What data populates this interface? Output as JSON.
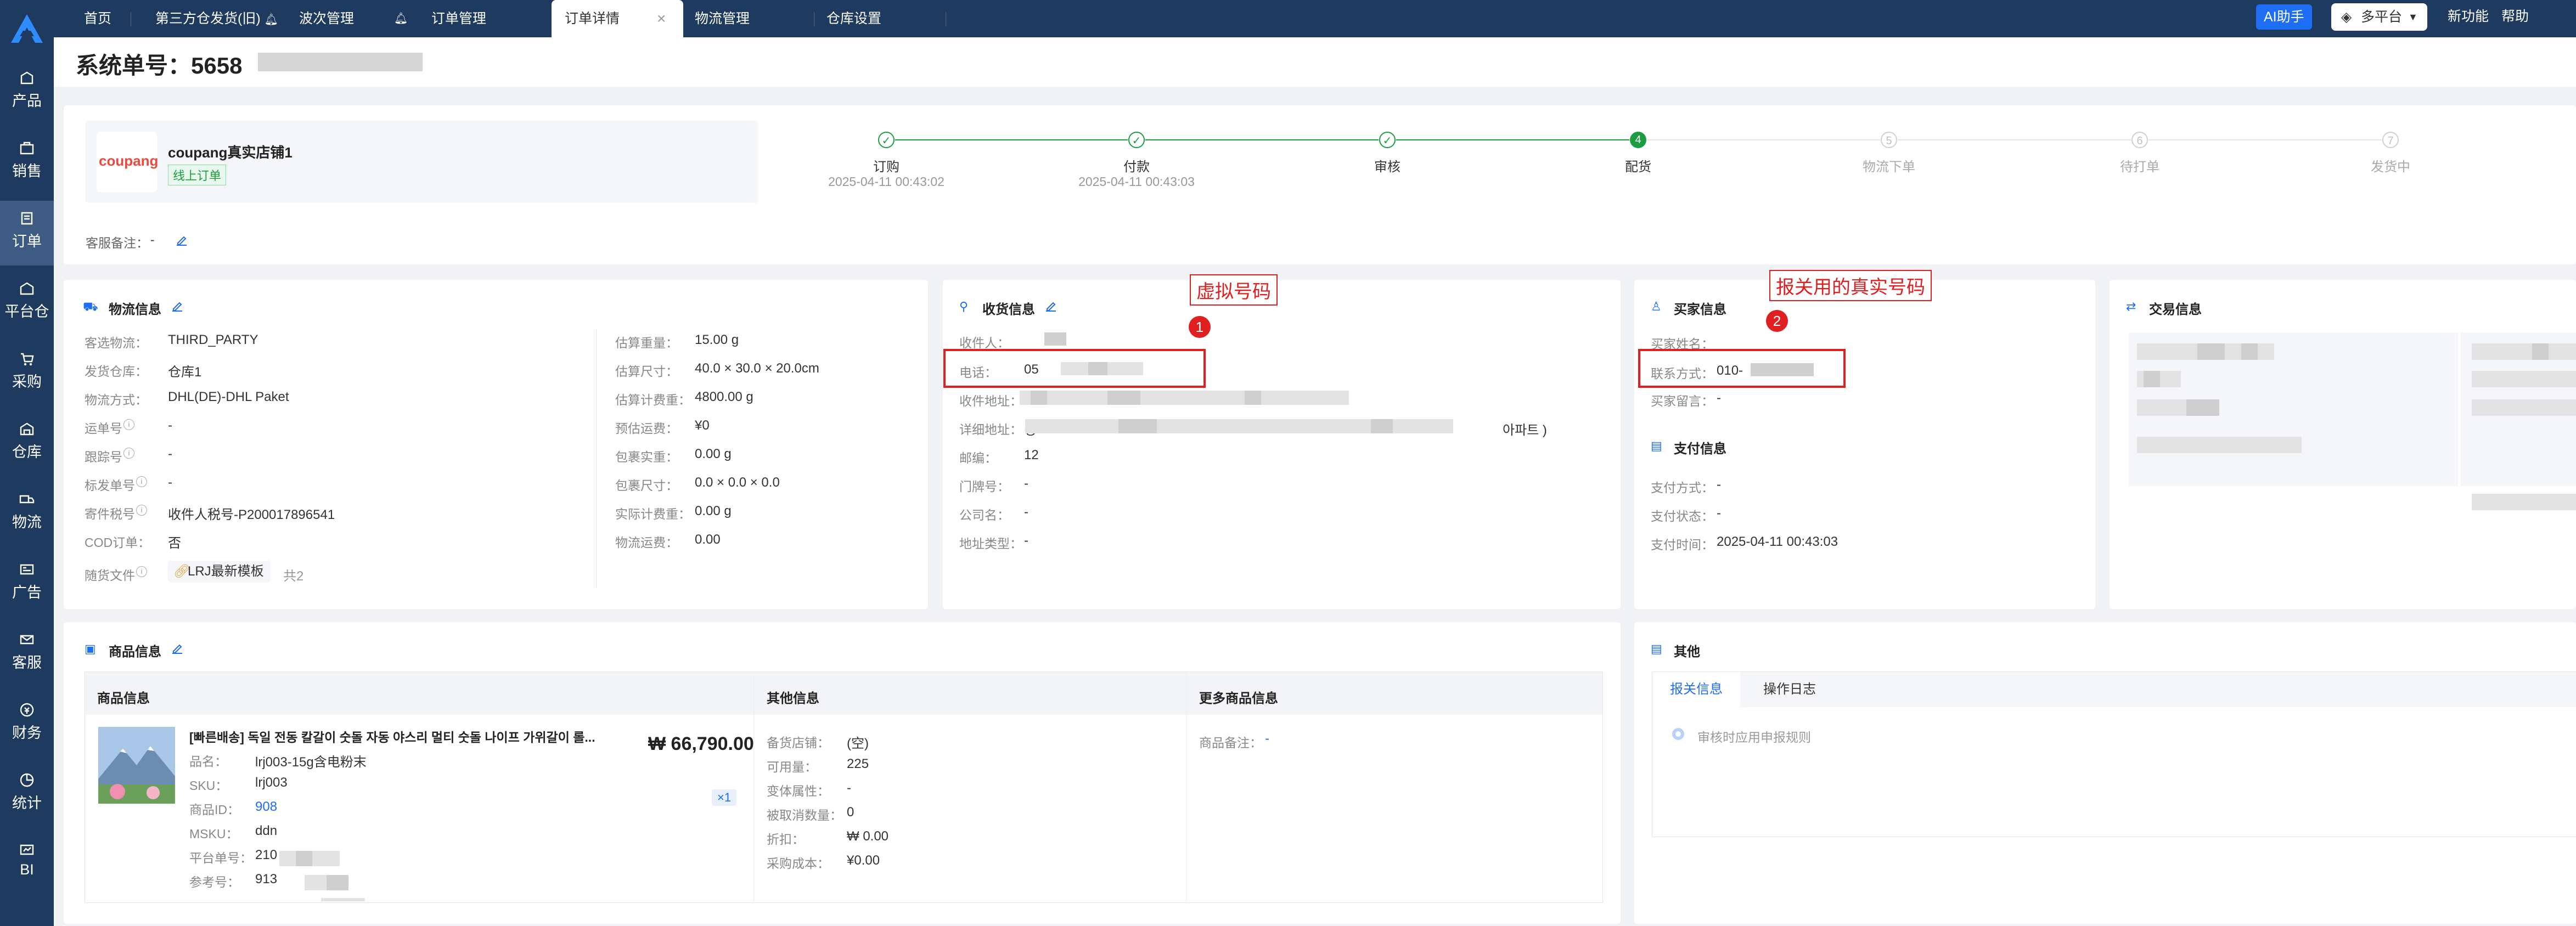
{
  "sidebar": {
    "items": [
      {
        "label": "产品",
        "icon": "product-icon"
      },
      {
        "label": "销售",
        "icon": "sales-icon"
      },
      {
        "label": "订单",
        "icon": "order-icon",
        "active": true
      },
      {
        "label": "平台仓",
        "icon": "platform-warehouse-icon"
      },
      {
        "label": "采购",
        "icon": "purchase-icon"
      },
      {
        "label": "仓库",
        "icon": "warehouse-icon"
      },
      {
        "label": "物流",
        "icon": "logistics-icon"
      },
      {
        "label": "广告",
        "icon": "ads-icon"
      },
      {
        "label": "客服",
        "icon": "service-icon"
      },
      {
        "label": "财务",
        "icon": "finance-icon"
      },
      {
        "label": "统计",
        "icon": "stats-icon"
      },
      {
        "label": "BI",
        "icon": "bi-icon"
      }
    ]
  },
  "topbar": {
    "tabs": [
      {
        "label": "首页"
      },
      {
        "label": "第三方仓发货(旧)"
      },
      {
        "label": "波次管理"
      },
      {
        "label": "订单管理"
      },
      {
        "label": "订单详情",
        "active": true
      },
      {
        "label": "物流管理"
      },
      {
        "label": "仓库设置"
      }
    ],
    "ai_label": "AI助手",
    "platform_label": "多平台",
    "new_features": "新功能",
    "help": "帮助"
  },
  "page": {
    "title": "系统单号：5658"
  },
  "store": {
    "logo_text": "coupang",
    "name": "coupang真实店铺1",
    "tag": "线上订单"
  },
  "progress": [
    {
      "num": "1",
      "label": "订购",
      "time": "2025-04-11 00:43:02",
      "done": true
    },
    {
      "num": "2",
      "label": "付款",
      "time": "2025-04-11 00:43:03",
      "done": true
    },
    {
      "num": "3",
      "label": "审核",
      "time": "",
      "done": true
    },
    {
      "num": "4",
      "label": "配货",
      "time": "",
      "current": true
    },
    {
      "num": "5",
      "label": "物流下单",
      "time": ""
    },
    {
      "num": "6",
      "label": "待打单",
      "time": ""
    },
    {
      "num": "7",
      "label": "发货中",
      "time": ""
    }
  ],
  "remark": {
    "label": "客服备注：",
    "value": "-"
  },
  "logistics": {
    "title": "物流信息",
    "left": [
      {
        "label": "客选物流：",
        "value": "THIRD_PARTY"
      },
      {
        "label": "发货仓库：",
        "value": "仓库1"
      },
      {
        "label": "物流方式：",
        "value": "DHL(DE)-DHL Paket"
      },
      {
        "label": "运单号",
        "value": "-"
      },
      {
        "label": "跟踪号",
        "value": "-"
      },
      {
        "label": "标发单号",
        "value": "-"
      },
      {
        "label": "寄件税号",
        "value": "收件人税号-P200017896541"
      },
      {
        "label": "COD订单：",
        "value": "否"
      },
      {
        "label": "随货文件",
        "value": "LRJ最新模板",
        "extra": "共2"
      }
    ],
    "right": [
      {
        "label": "估算重量：",
        "value": "15.00 g"
      },
      {
        "label": "估算尺寸：",
        "value": "40.0 × 30.0 × 20.0cm"
      },
      {
        "label": "估算计费重：",
        "value": "4800.00 g"
      },
      {
        "label": "预估运费：",
        "value": "¥0"
      },
      {
        "label": "包裹实重：",
        "value": "0.00 g"
      },
      {
        "label": "包裹尺寸：",
        "value": "0.0 × 0.0 × 0.0"
      },
      {
        "label": "实际计费重：",
        "value": "0.00 g"
      },
      {
        "label": "物流运费：",
        "value": "0.00"
      }
    ]
  },
  "shipping": {
    "title": "收货信息",
    "rows": [
      {
        "label": "收件人：",
        "value": " "
      },
      {
        "label": "电话：",
        "value": "05"
      },
      {
        "label": "收件地址：",
        "value": "So"
      },
      {
        "label": "详细地址：",
        "value": "경",
        "tail": "아파트 )"
      },
      {
        "label": "邮编：",
        "value": "12"
      },
      {
        "label": "门牌号：",
        "value": "-"
      },
      {
        "label": "公司名：",
        "value": "-"
      },
      {
        "label": "地址类型：",
        "value": "-"
      }
    ]
  },
  "buyer": {
    "title": "买家信息",
    "rows": [
      {
        "label": "买家姓名：",
        "value": " "
      },
      {
        "label": "联系方式：",
        "value": "010-"
      },
      {
        "label": "买家留言：",
        "value": "-"
      }
    ]
  },
  "payment": {
    "title": "支付信息",
    "rows": [
      {
        "label": "支付方式：",
        "value": "-"
      },
      {
        "label": "支付状态：",
        "value": "-"
      },
      {
        "label": "支付时间：",
        "value": "2025-04-11 00:43:03"
      }
    ]
  },
  "trade": {
    "title": "交易信息"
  },
  "annotations": [
    {
      "num": "1",
      "text": "虚拟号码"
    },
    {
      "num": "2",
      "text": "报关用的真实号码"
    }
  ],
  "goods": {
    "title": "商品信息",
    "headers": [
      "商品信息",
      "其他信息",
      "更多商品信息"
    ],
    "product_title": "[빠른배송] 독일 전동 칼갈이 숫돌 자동 야스리 멀티 숫돌 나이프 가위갈이 롤...",
    "price": "₩ 66,790.00",
    "qty": "×1",
    "fields": [
      {
        "label": "品名：",
        "value": "lrj003-15g含电粉末"
      },
      {
        "label": "SKU：",
        "value": "lrj003"
      },
      {
        "label": "商品ID：",
        "value": "908",
        "link": true
      },
      {
        "label": "MSKU：",
        "value": "ddn"
      },
      {
        "label": "平台单号：",
        "value": "210"
      },
      {
        "label": "参考号：",
        "value": "913"
      }
    ],
    "other": [
      {
        "label": "备货店铺：",
        "value": "(空)"
      },
      {
        "label": "可用量：",
        "value": "225"
      },
      {
        "label": "变体属性：",
        "value": "-"
      },
      {
        "label": "被取消数量：",
        "value": "0"
      },
      {
        "label": "折扣：",
        "value": "₩ 0.00"
      },
      {
        "label": "采购成本：",
        "value": "¥0.00"
      }
    ],
    "more": {
      "label": "商品备注：",
      "value": "-"
    }
  },
  "other": {
    "title": "其他",
    "tabs": [
      "报关信息",
      "操作日志"
    ],
    "rule": "审核时应用申报规则"
  },
  "colors": {
    "nav": "#1f3a5f",
    "accent": "#1e6df5",
    "success": "#1a9e3f",
    "annotation": "#e02020"
  }
}
